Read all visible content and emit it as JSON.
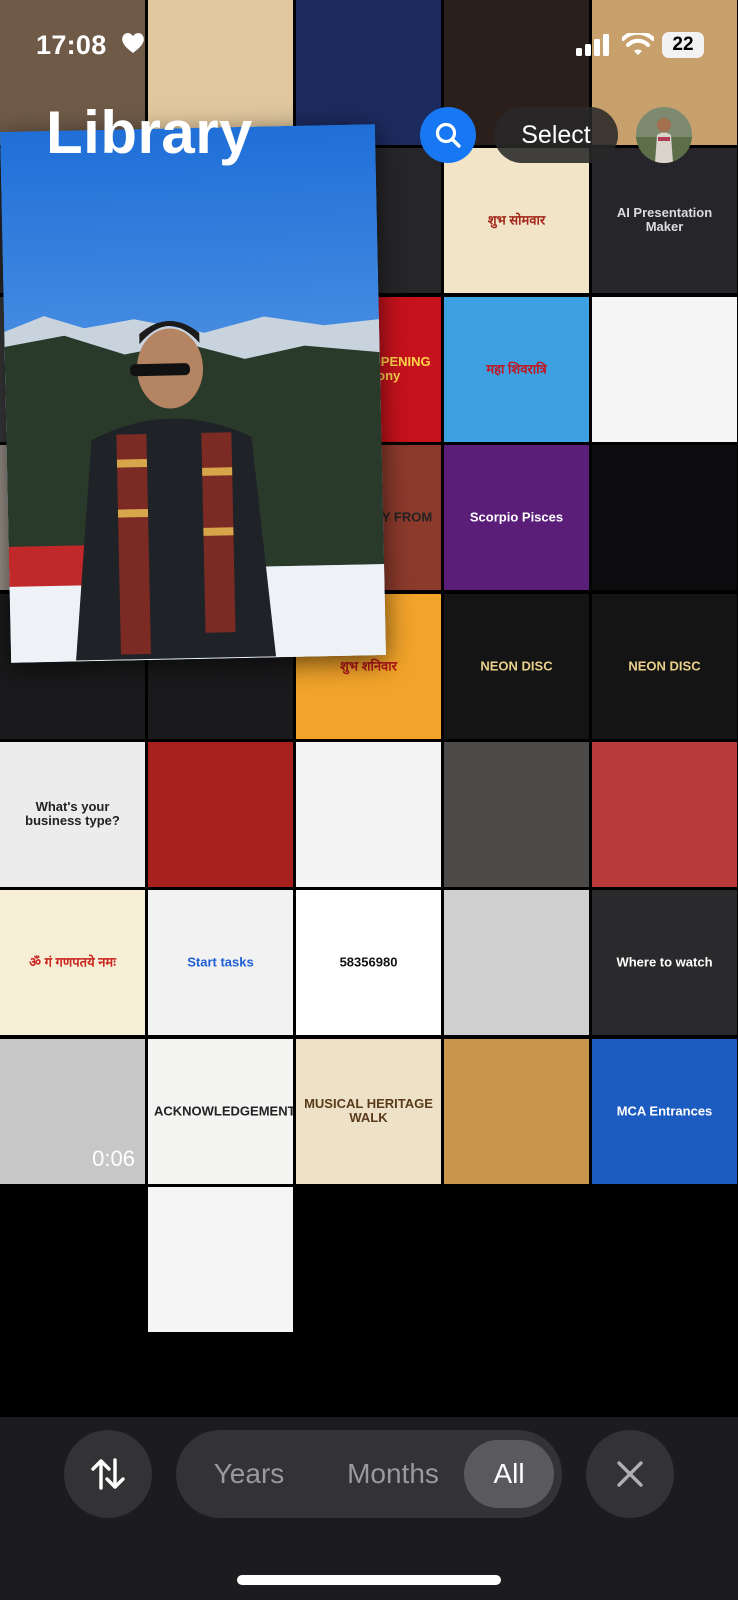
{
  "status_bar": {
    "time": "17:08",
    "battery": "22"
  },
  "header": {
    "title": "Library",
    "select_label": "Select"
  },
  "tiles": [
    {
      "bg": "#6f5a48",
      "text": "",
      "color": "#fff"
    },
    {
      "bg": "#e0c79e",
      "text": "",
      "color": "#fff"
    },
    {
      "bg": "#1c2a5e",
      "text": "",
      "color": "#fff"
    },
    {
      "bg": "#2a1f1a",
      "text": "",
      "color": "#fff"
    },
    {
      "bg": "#c8a06c",
      "text": "",
      "color": "#fff"
    },
    {
      "bg": "#2a2a2e",
      "text": "",
      "color": "#fff"
    },
    {
      "bg": "#2b2b2f",
      "text": "",
      "color": "#fff"
    },
    {
      "bg": "#262629",
      "text": "",
      "color": "#fff"
    },
    {
      "bg": "#f2e4c6",
      "text": "शुभ सोमवार",
      "color": "#a3271b"
    },
    {
      "bg": "#25252a",
      "text": "AI Presentation Maker",
      "color": "#dcdcdc"
    },
    {
      "bg": "#3a3a3c",
      "text": "",
      "color": "#fff"
    },
    {
      "bg": "#e9e7e4",
      "text": "",
      "color": "#222"
    },
    {
      "bg": "#c5121c",
      "text": "Grand RE-OPENING Ceremony",
      "color": "#ffd54a"
    },
    {
      "bg": "#3da0e0",
      "text": "महा शिवरात्रि",
      "color": "#c2151f"
    },
    {
      "bg": "#f5f5f5",
      "text": "",
      "color": "#444"
    },
    {
      "bg": "#9a9288",
      "text": "",
      "color": "#fff"
    },
    {
      "bg": "#a49c90",
      "text": "",
      "color": "#fff"
    },
    {
      "bg": "#8c3a2c",
      "text": "MY JOURNEY FROM",
      "color": "#222"
    },
    {
      "bg": "#5a1e78",
      "text": "Scorpio Pisces",
      "color": "#fff"
    },
    {
      "bg": "#0c0c0e",
      "text": "",
      "color": "#ccc"
    },
    {
      "bg": "#1a1a1c",
      "text": "",
      "color": "#fff"
    },
    {
      "bg": "#1a1a1c",
      "text": "",
      "color": "#fff"
    },
    {
      "bg": "#f1a32a",
      "text": "शुभ शनिवार",
      "color": "#b1141a"
    },
    {
      "bg": "#141414",
      "text": "NEON DISC",
      "color": "#e8d08a"
    },
    {
      "bg": "#141414",
      "text": "NEON DISC",
      "color": "#e8d08a"
    },
    {
      "bg": "#ececec",
      "text": "What's your business type?",
      "color": "#222"
    },
    {
      "bg": "#a8201e",
      "text": "",
      "color": "#fff"
    },
    {
      "bg": "#f4f4f4",
      "text": "",
      "color": "#1b2a8a"
    },
    {
      "bg": "#4c4a48",
      "text": "",
      "color": "#fff"
    },
    {
      "bg": "#b83a3a",
      "text": "",
      "color": "#fff"
    },
    {
      "bg": "#f6efd5",
      "text": "ॐ गं गणपतये नमः",
      "color": "#c8231c"
    },
    {
      "bg": "#f2f2f2",
      "text": "Start tasks",
      "color": "#1f5fd6"
    },
    {
      "bg": "#ffffff",
      "text": "58356980",
      "color": "#111"
    },
    {
      "bg": "#cfcfcf",
      "text": "",
      "color": "#fff"
    },
    {
      "bg": "#2a2a2c",
      "text": "Where to watch",
      "color": "#fff"
    },
    {
      "bg": "#c7c7c7",
      "text": "",
      "color": "#fff",
      "duration": "0:06"
    },
    {
      "bg": "#f4f4f2",
      "text": "ACKNOWLEDGEMENT",
      "color": "#222"
    },
    {
      "bg": "#ede2c8",
      "text": "MUSICAL HERITAGE WALK",
      "color": "#5a3a1a"
    },
    {
      "bg": "#c9954a",
      "text": "",
      "color": "#fff"
    },
    {
      "bg": "#1c5cc0",
      "text": "MCA Entrances",
      "color": "#fff"
    },
    {
      "bg": "#000000",
      "text": "",
      "color": "#fff"
    },
    {
      "bg": "#f5f5f5",
      "text": "",
      "color": "#fff"
    }
  ],
  "bottom_bar": {
    "segments": {
      "years": "Years",
      "months": "Months",
      "all": "All"
    }
  },
  "colors": {
    "accent": "#1877f2",
    "bar_bg": "#1c1c1e",
    "pill_bg": "#333335",
    "active_pill": "#5a5a5e"
  }
}
